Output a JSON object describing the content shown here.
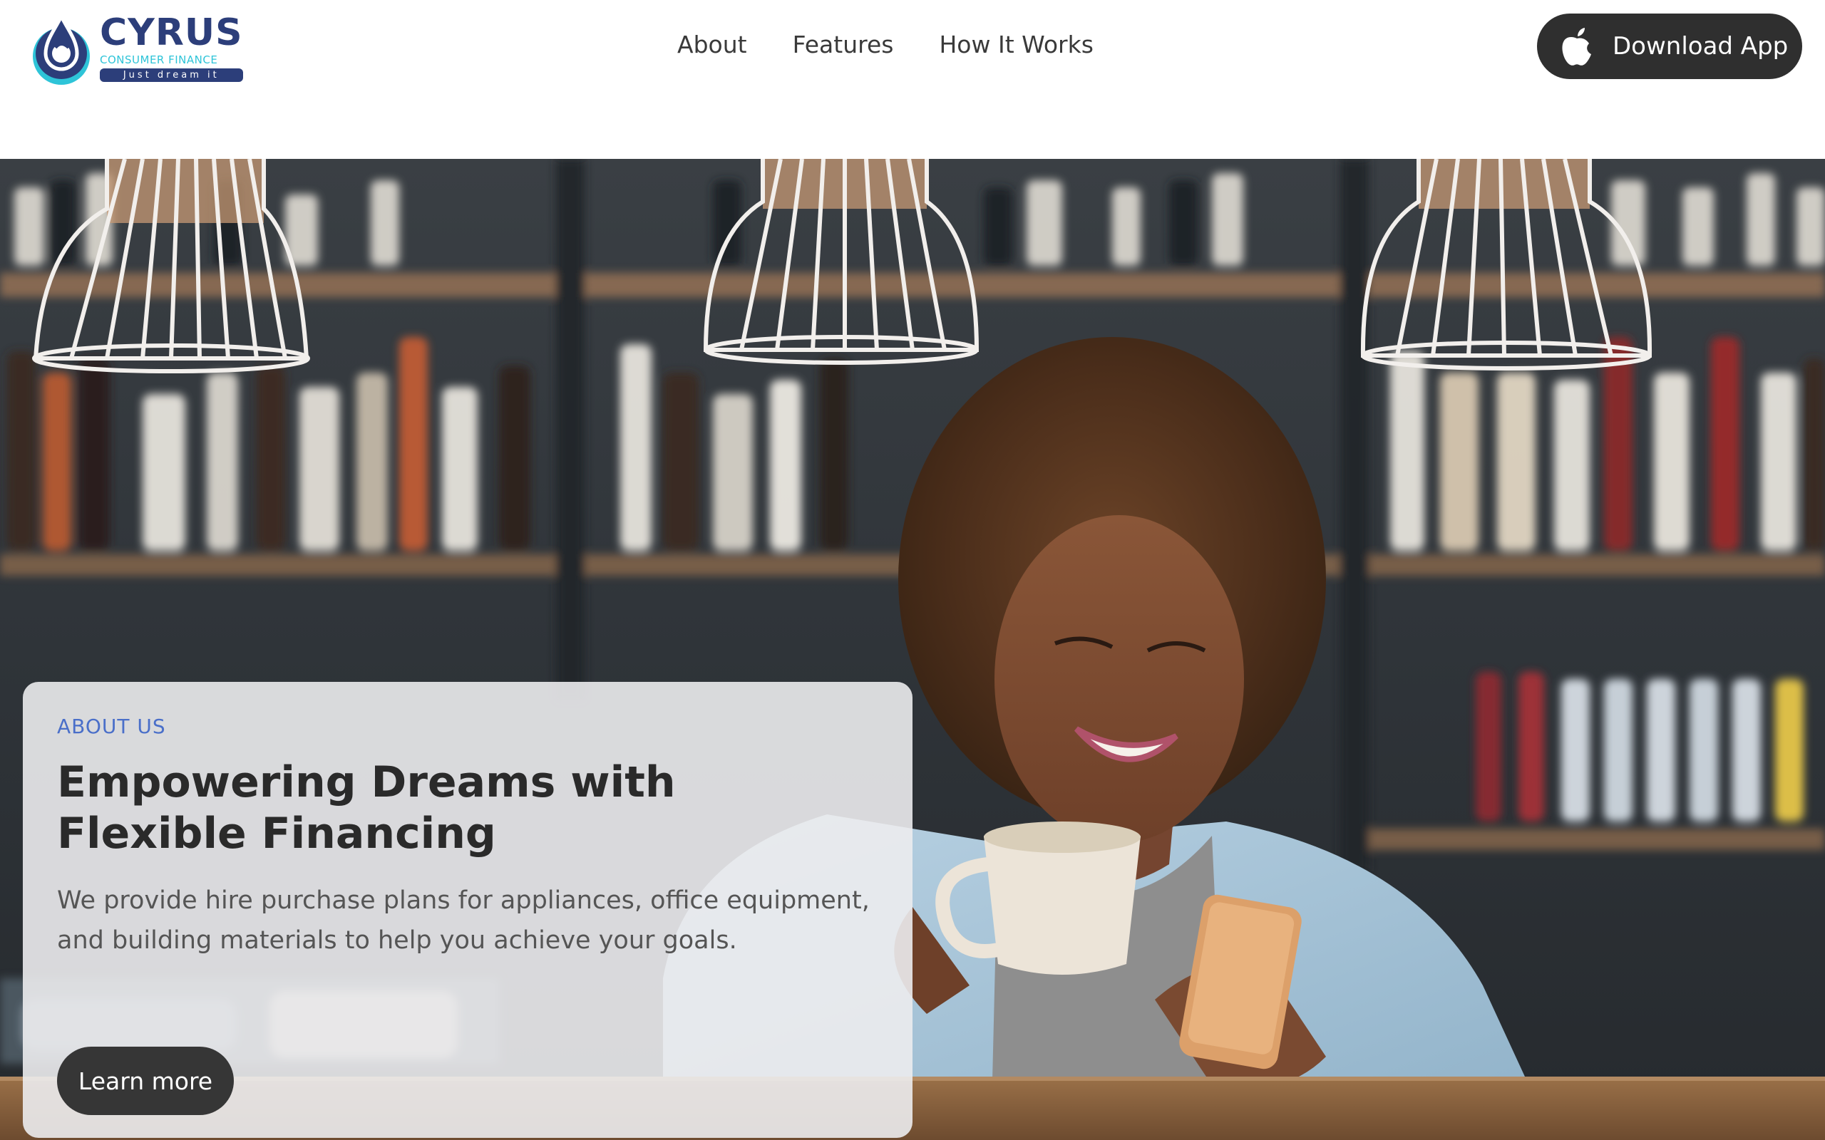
{
  "brand": {
    "name": "CYRUS",
    "subtitle": "CONSUMER FINANCE",
    "tagline": "Just dream it"
  },
  "nav": {
    "items": [
      {
        "label": "About"
      },
      {
        "label": "Features"
      },
      {
        "label": "How It Works"
      }
    ]
  },
  "header": {
    "download_label": "Download App",
    "download_icon": "apple-icon"
  },
  "about": {
    "eyebrow": "ABOUT US",
    "title": "Empowering Dreams with Flexible Financing",
    "description": "We provide hire purchase plans for appliances, office equipment, and building materials to help you achieve your goals.",
    "cta_label": "Learn more"
  },
  "colors": {
    "brand_navy": "#2c3e7a",
    "brand_cyan": "#2ec4d8",
    "eyebrow_blue": "#4a6fc9",
    "button_dark": "#2f2f2f"
  }
}
